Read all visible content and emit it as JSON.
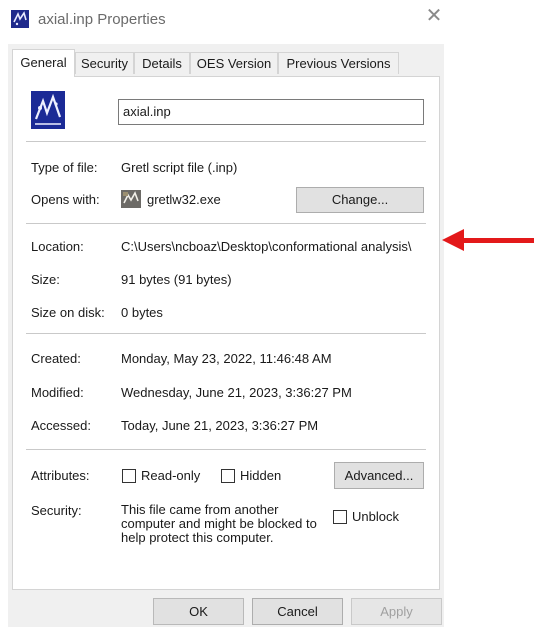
{
  "window": {
    "title": "axial.inp Properties",
    "close_glyph": "✕"
  },
  "tabs": [
    {
      "label": "General",
      "active": true
    },
    {
      "label": "Security",
      "active": false
    },
    {
      "label": "Details",
      "active": false
    },
    {
      "label": "OES Version",
      "active": false
    },
    {
      "label": "Previous Versions",
      "active": false
    }
  ],
  "file": {
    "name": "axial.inp",
    "icon": "gretl-file-icon"
  },
  "properties": {
    "type_label": "Type of file:",
    "type_value": "Gretl script file (.inp)",
    "opens_label": "Opens with:",
    "opens_value": "gretlw32.exe",
    "opens_icon": "gretl-app-icon",
    "change_button": "Change...",
    "location_label": "Location:",
    "location_value": "C:\\Users\\ncboaz\\Desktop\\conformational analysis\\",
    "size_label": "Size:",
    "size_value": "91 bytes (91 bytes)",
    "size_disk_label": "Size on disk:",
    "size_disk_value": "0 bytes",
    "created_label": "Created:",
    "created_value": "Monday, May 23, 2022, 11:46:48 AM",
    "modified_label": "Modified:",
    "modified_value": "Wednesday, June 21, 2023, 3:36:27 PM",
    "accessed_label": "Accessed:",
    "accessed_value": "Today, June 21, 2023, 3:36:27 PM",
    "attributes_label": "Attributes:",
    "readonly_label": "Read-only",
    "hidden_label": "Hidden",
    "advanced_button": "Advanced...",
    "security_label": "Security:",
    "security_line1": "This file came from another",
    "security_line2": "computer and might be blocked to",
    "security_line3": "help protect this computer.",
    "unblock_label": "Unblock"
  },
  "footer": {
    "ok": "OK",
    "cancel": "Cancel",
    "apply": "Apply"
  },
  "annotation": {
    "arrow_color": "#e3191a"
  }
}
